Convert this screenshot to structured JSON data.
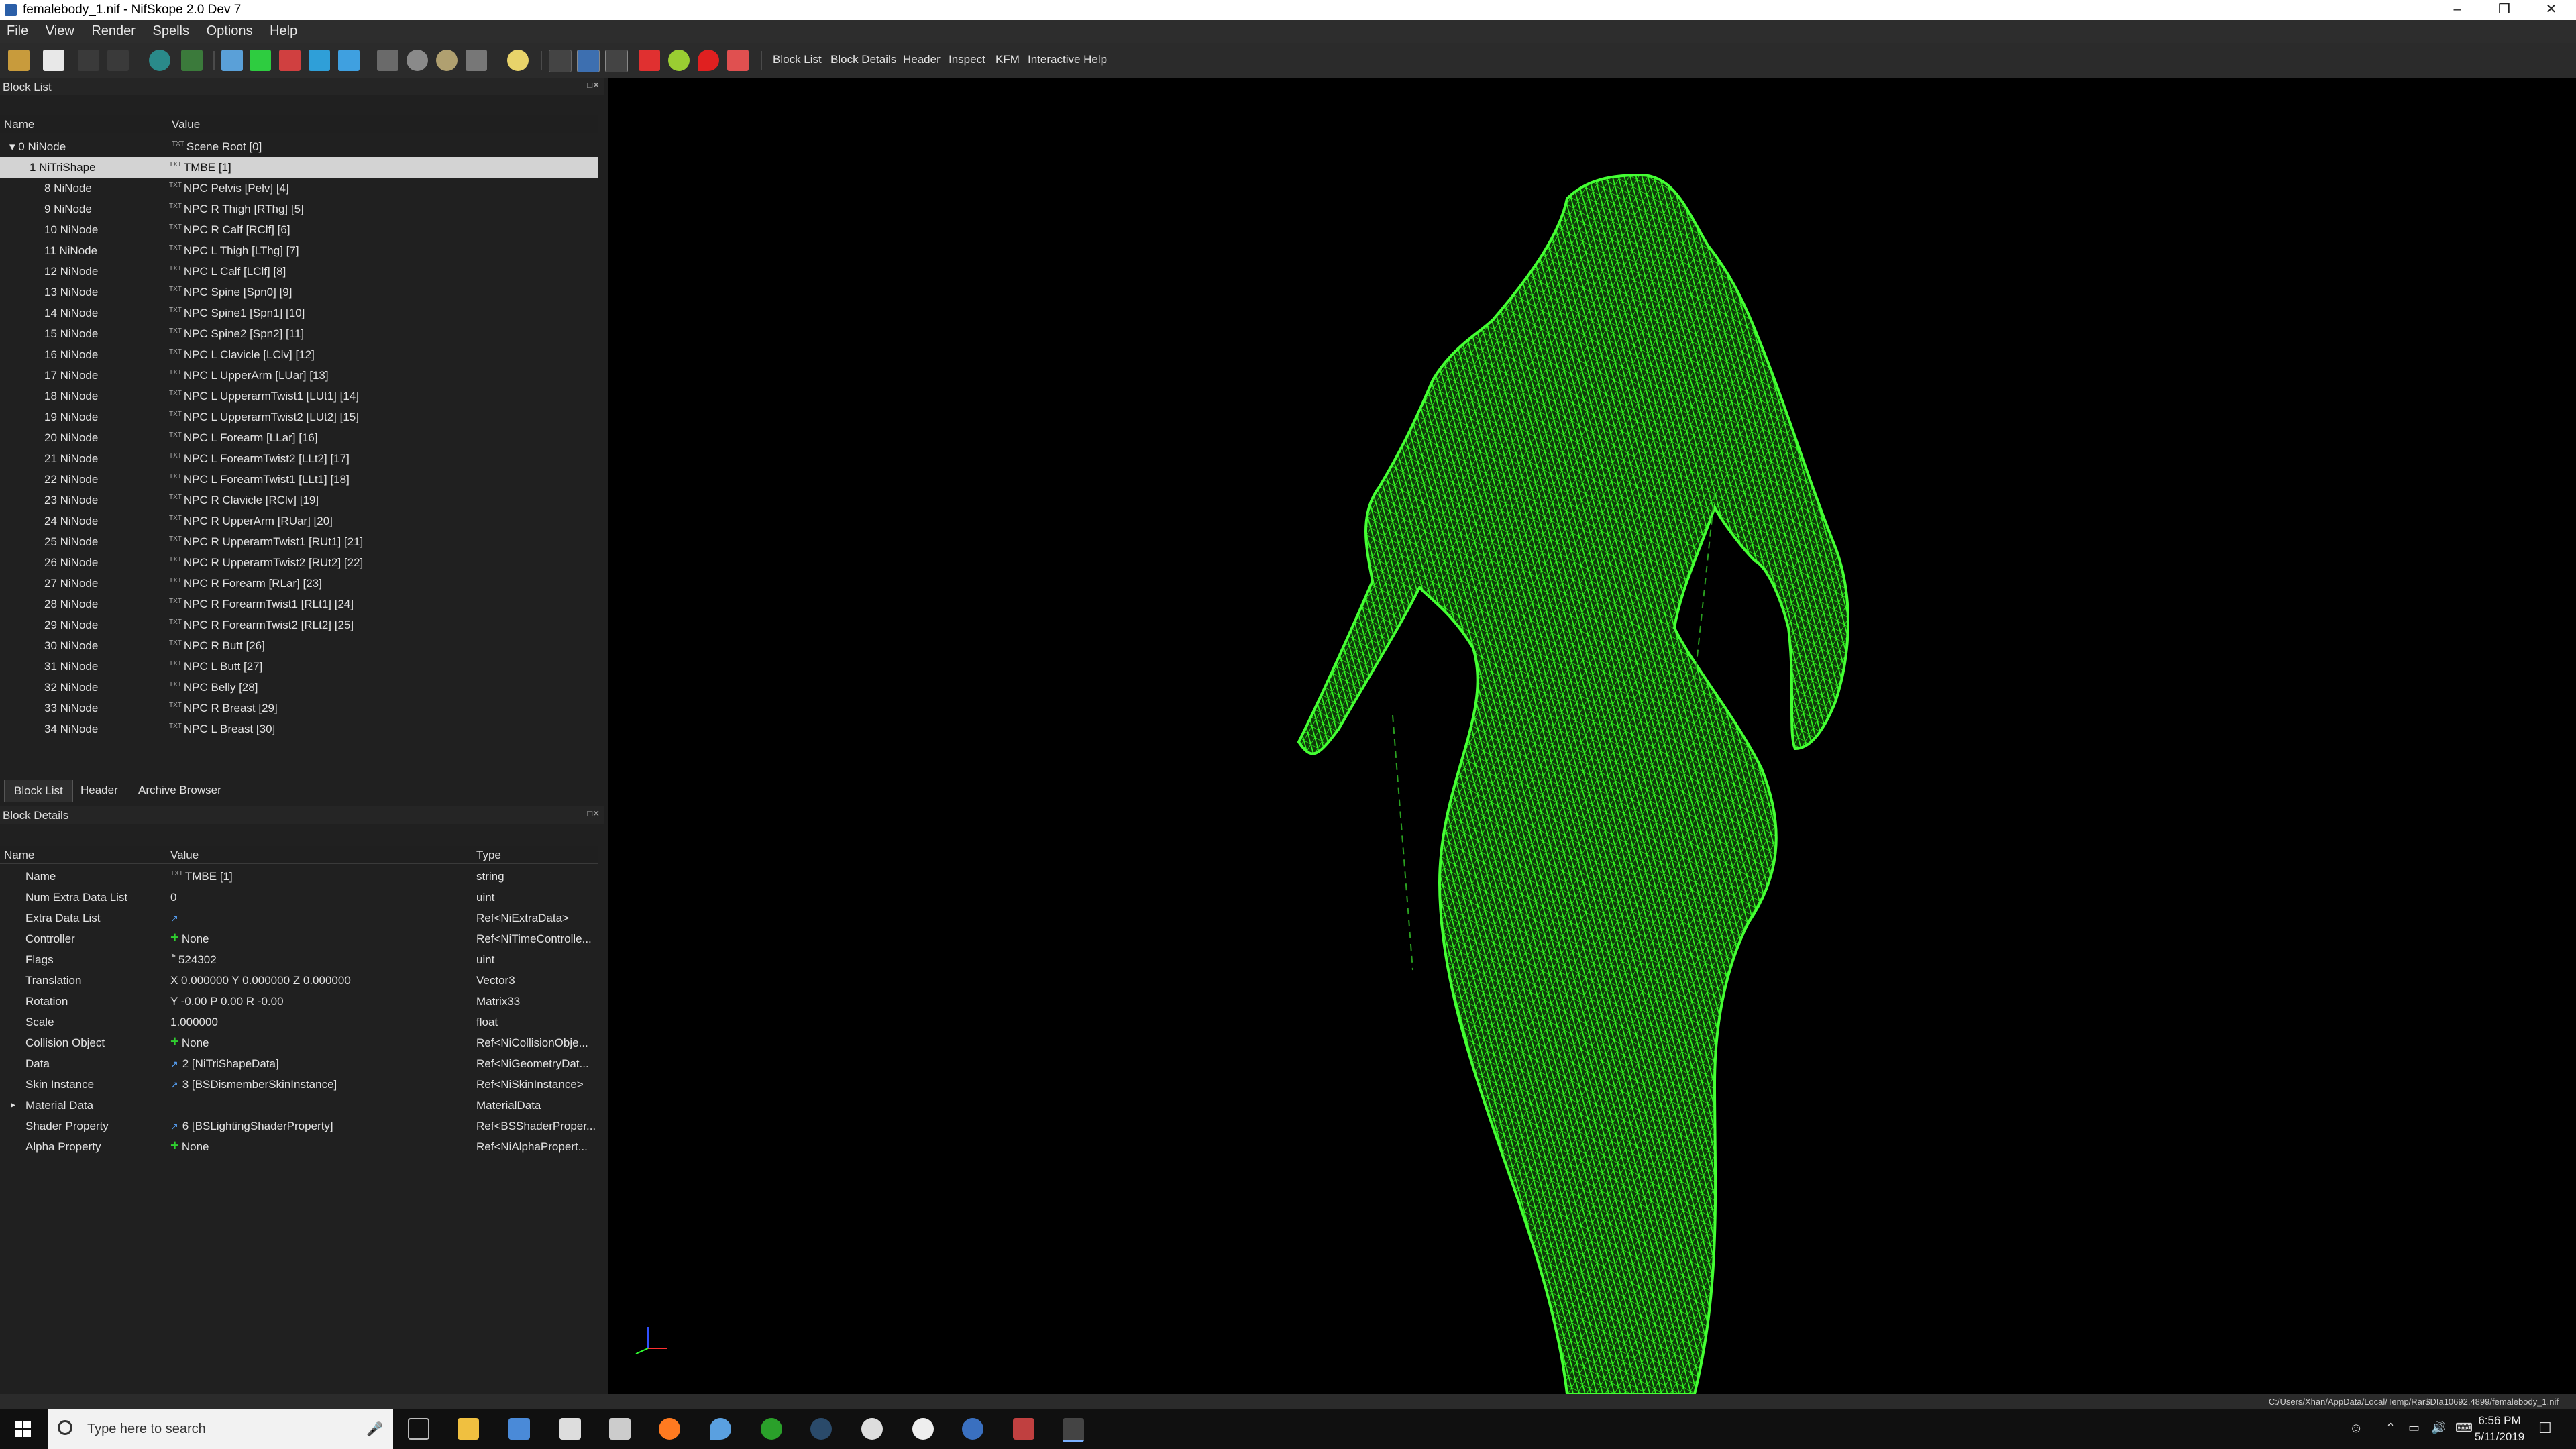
{
  "window": {
    "title": "femalebody_1.nif - NifSkope 2.0 Dev 7"
  },
  "menu": [
    "File",
    "View",
    "Render",
    "Spells",
    "Options",
    "Help"
  ],
  "toolbar": {
    "links": [
      "Block List",
      "Block Details",
      "Header",
      "Inspect",
      "KFM",
      "Interactive Help"
    ]
  },
  "block_list": {
    "title": "Block List",
    "columns": [
      "Name",
      "Value"
    ],
    "root": {
      "name": "0 NiNode",
      "value": "Scene Root [0]"
    },
    "rows": [
      {
        "name": "1 NiTriShape",
        "value": "TMBE [1]"
      },
      {
        "name": "8 NiNode",
        "value": "NPC Pelvis [Pelv] [4]"
      },
      {
        "name": "9 NiNode",
        "value": "NPC R Thigh [RThg] [5]"
      },
      {
        "name": "10 NiNode",
        "value": "NPC R Calf [RClf] [6]"
      },
      {
        "name": "11 NiNode",
        "value": "NPC L Thigh [LThg] [7]"
      },
      {
        "name": "12 NiNode",
        "value": "NPC L Calf [LClf] [8]"
      },
      {
        "name": "13 NiNode",
        "value": "NPC Spine [Spn0] [9]"
      },
      {
        "name": "14 NiNode",
        "value": "NPC Spine1 [Spn1] [10]"
      },
      {
        "name": "15 NiNode",
        "value": "NPC Spine2 [Spn2] [11]"
      },
      {
        "name": "16 NiNode",
        "value": "NPC L Clavicle [LClv] [12]"
      },
      {
        "name": "17 NiNode",
        "value": "NPC L UpperArm [LUar] [13]"
      },
      {
        "name": "18 NiNode",
        "value": "NPC L UpperarmTwist1 [LUt1] [14]"
      },
      {
        "name": "19 NiNode",
        "value": "NPC L UpperarmTwist2 [LUt2] [15]"
      },
      {
        "name": "20 NiNode",
        "value": "NPC L Forearm [LLar] [16]"
      },
      {
        "name": "21 NiNode",
        "value": "NPC L ForearmTwist2 [LLt2] [17]"
      },
      {
        "name": "22 NiNode",
        "value": "NPC L ForearmTwist1 [LLt1] [18]"
      },
      {
        "name": "23 NiNode",
        "value": "NPC R Clavicle [RClv] [19]"
      },
      {
        "name": "24 NiNode",
        "value": "NPC R UpperArm [RUar] [20]"
      },
      {
        "name": "25 NiNode",
        "value": "NPC R UpperarmTwist1 [RUt1] [21]"
      },
      {
        "name": "26 NiNode",
        "value": "NPC R UpperarmTwist2 [RUt2] [22]"
      },
      {
        "name": "27 NiNode",
        "value": "NPC R Forearm [RLar] [23]"
      },
      {
        "name": "28 NiNode",
        "value": "NPC R ForearmTwist1 [RLt1] [24]"
      },
      {
        "name": "29 NiNode",
        "value": "NPC R ForearmTwist2 [RLt2] [25]"
      },
      {
        "name": "30 NiNode",
        "value": "NPC R Butt [26]"
      },
      {
        "name": "31 NiNode",
        "value": "NPC L Butt [27]"
      },
      {
        "name": "32 NiNode",
        "value": "NPC Belly [28]"
      },
      {
        "name": "33 NiNode",
        "value": "NPC R Breast [29]"
      },
      {
        "name": "34 NiNode",
        "value": "NPC L Breast [30]"
      }
    ]
  },
  "tabs": [
    "Block List",
    "Header",
    "Archive Browser"
  ],
  "block_details": {
    "title": "Block Details",
    "columns": [
      "Name",
      "Value",
      "Type"
    ],
    "rows": [
      {
        "name": "Name",
        "value": "TMBE [1]",
        "type": "string"
      },
      {
        "name": "Num Extra Data List",
        "value": "0",
        "type": "uint"
      },
      {
        "name": "Extra Data List",
        "value": "",
        "type": "Ref<NiExtraData>"
      },
      {
        "name": "Controller",
        "value": "None",
        "type": "Ref<NiTimeControlle..."
      },
      {
        "name": "Flags",
        "value": "524302",
        "type": "uint"
      },
      {
        "name": "Translation",
        "value": "X 0.000000 Y 0.000000 Z 0.000000",
        "type": "Vector3"
      },
      {
        "name": "Rotation",
        "value": "Y -0.00 P 0.00 R -0.00",
        "type": "Matrix33"
      },
      {
        "name": "Scale",
        "value": "1.000000",
        "type": "float"
      },
      {
        "name": "Collision Object",
        "value": "None",
        "type": "Ref<NiCollisionObje..."
      },
      {
        "name": "Data",
        "value": "2 [NiTriShapeData]",
        "type": "Ref<NiGeometryDat..."
      },
      {
        "name": "Skin Instance",
        "value": "3 [BSDismemberSkinInstance]",
        "type": "Ref<NiSkinInstance>"
      },
      {
        "name": "Material Data",
        "value": "",
        "type": "MaterialData"
      },
      {
        "name": "Shader Property",
        "value": "6 [BSLightingShaderProperty]",
        "type": "Ref<BSShaderProper..."
      },
      {
        "name": "Alpha Property",
        "value": "None",
        "type": "Ref<NiAlphaPropert..."
      }
    ]
  },
  "viewport": {
    "mesh_color": "#33ff22"
  },
  "statusbar": {
    "path": "C:/Users/Xhan/AppData/Local/Temp/Rar$DIa10692.4899/femalebody_1.nif"
  },
  "taskbar": {
    "search_placeholder": "Type here to search",
    "time": "6:56 PM",
    "date": "5/11/2019"
  }
}
